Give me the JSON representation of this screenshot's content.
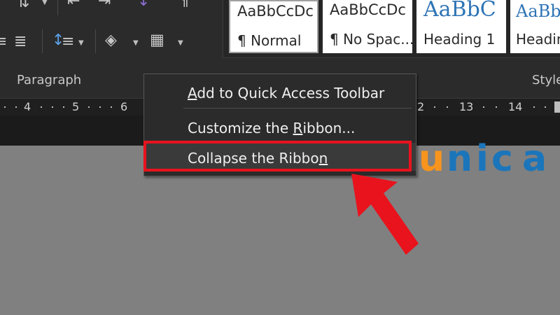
{
  "ribbon": {
    "group_paragraph_label": "Paragraph",
    "group_styles_label": "Style",
    "icons": [
      "sort-icon",
      "decrease-indent-icon",
      "increase-indent-icon",
      "show-hide-formatting-icon",
      "justify-icon",
      "line-spacing-icon",
      "shading-icon",
      "borders-icon"
    ]
  },
  "styles": [
    {
      "preview": "AaBbCcDc",
      "name": "¶ Normal",
      "selected": true
    },
    {
      "preview": "AaBbCcDc",
      "name": "¶ No Spac..."
    },
    {
      "preview": "AaBbC",
      "name": "Heading 1",
      "preview_color": "#2e74b5"
    },
    {
      "preview": "AaBb",
      "name": "Headin",
      "preview_color": "#2e74b5"
    }
  ],
  "ruler": {
    "numbers": [
      "4",
      "5",
      "6",
      "2",
      "13",
      "14"
    ]
  },
  "context_menu": {
    "items": [
      {
        "label": "Add to Quick Access Toolbar",
        "underline": "A"
      },
      {
        "label": "Customize the Ribbon...",
        "underline": "R"
      },
      {
        "label": "Collapse the Ribbon",
        "underline": "n",
        "highlighted": true
      }
    ]
  },
  "annotation": {
    "highlight_color": "#e8131d",
    "arrow_color": "#e8131d"
  },
  "watermark": {
    "text": "unica",
    "letters": [
      "u",
      "n",
      "i",
      "c",
      "a"
    ],
    "colors": [
      "#f7941d",
      "#1b75bb",
      "#1b75bb",
      "#1b75bb",
      "#1b75bb"
    ]
  }
}
